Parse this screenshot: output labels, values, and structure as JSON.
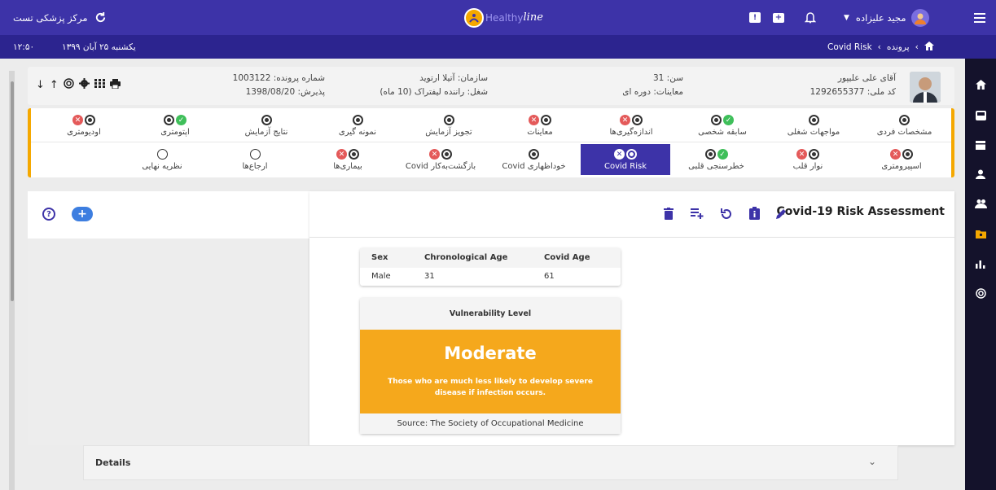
{
  "topbar": {
    "center_name": "مرکز پزشکی تست",
    "logo_text_1": "Healthy",
    "logo_text_2": "line",
    "user_name": "مجید علیزاده"
  },
  "subbar": {
    "date": "یکشنبه ۲۵ آبان ۱۳۹۹",
    "time": "۱۲:۵۰",
    "breadcrumb_1": "پرونده",
    "breadcrumb_2": "Covid Risk"
  },
  "patient": {
    "name": "آقای علی علیپور",
    "national_id": "کد ملی: 1292655377",
    "age": "سن: 31",
    "exam_type": "معاینات: دوره ای",
    "org": "سازمان: آتیلا ارتوید",
    "job": "شغل: راننده لیفتراک (10 ماه)",
    "file_no": "شماره پرونده: 1003122",
    "admission": "پذیرش: 1398/08/20"
  },
  "tabs_row1": [
    {
      "label": "مشخصات فردی"
    },
    {
      "label": "مواجهات شغلی"
    },
    {
      "label": "سابقه شخصی"
    },
    {
      "label": "اندازه‌گیری‌ها"
    },
    {
      "label": "معاینات"
    },
    {
      "label": "تجویز آزمایش"
    },
    {
      "label": "نمونه گیری"
    },
    {
      "label": "نتایج آزمایش"
    },
    {
      "label": "اپتومتری"
    },
    {
      "label": "اودیومتری"
    }
  ],
  "tabs_row2": [
    {
      "label": "اسپیرومتری"
    },
    {
      "label": "نوار قلب"
    },
    {
      "label": "خطرسنجی قلبی"
    },
    {
      "label": "Covid Risk"
    },
    {
      "label": "خوداظهاری Covid"
    },
    {
      "label": "بازگشت‌به‌کار Covid"
    },
    {
      "label": "بیماری‌ها"
    },
    {
      "label": "ارجاع‌ها"
    },
    {
      "label": "نظریه نهایی"
    }
  ],
  "modal": {
    "title": "Covid-19 Risk Assessment"
  },
  "age_table": {
    "headers": [
      "Sex",
      "Chronological Age",
      "Covid Age"
    ],
    "row": [
      "Male",
      "31",
      "61"
    ]
  },
  "vulnerability": {
    "header": "Vulnerability Level",
    "level": "Moderate",
    "description": "Those who are much less likely to develop severe disease if infection occurs.",
    "source": "Source: The Society of Occupational Medicine"
  },
  "details": {
    "label": "Details"
  },
  "colors": {
    "primary": "#3d33a8",
    "accent": "#f5a800",
    "moderate": "#f5a81c"
  }
}
